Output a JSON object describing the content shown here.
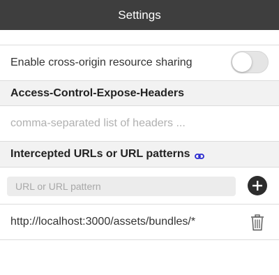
{
  "window": {
    "title": "Settings"
  },
  "cors": {
    "label": "Enable cross-origin resource sharing",
    "enabled": false
  },
  "expose_headers": {
    "title": "Access-Control-Expose-Headers",
    "value": "",
    "placeholder": "comma-separated list of headers ..."
  },
  "intercepted": {
    "title": "Intercepted URLs or URL patterns",
    "title_icon": "link-icon",
    "input_value": "",
    "input_placeholder": "URL or URL pattern",
    "add_icon": "plus-icon",
    "items": [
      {
        "url": "http://localhost:3000/assets/bundles/*",
        "delete_icon": "trash-icon"
      }
    ]
  },
  "colors": {
    "titlebar": "#3e3e3e",
    "section_bg": "#f2f2f2",
    "link_accent": "#2a2ad0"
  }
}
